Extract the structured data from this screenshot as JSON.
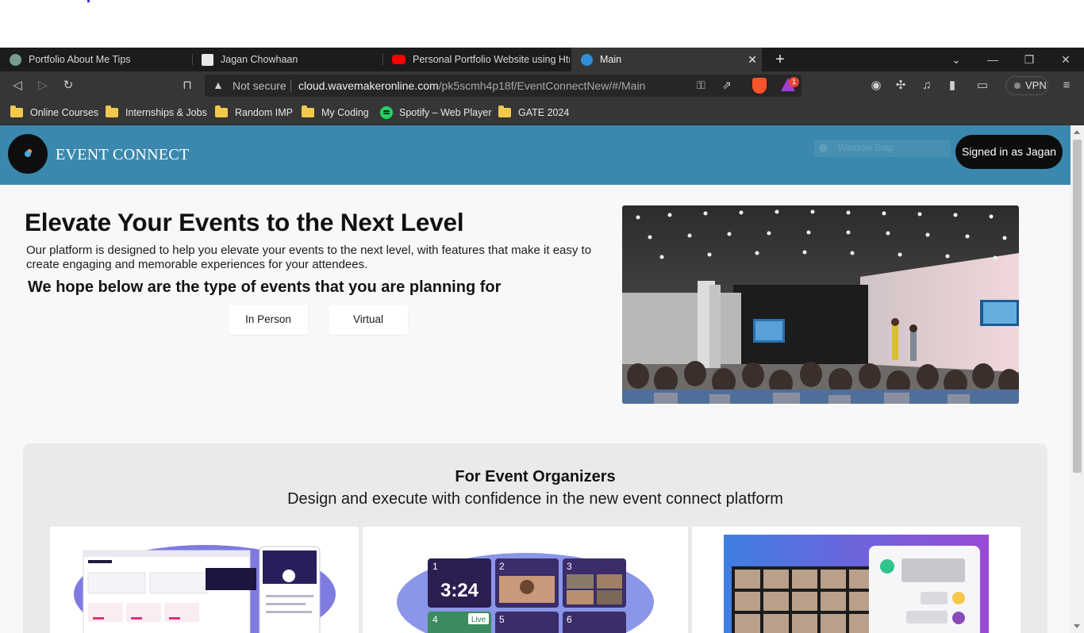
{
  "browser": {
    "tabs": [
      {
        "title": "Portfolio About Me Tips",
        "active": false
      },
      {
        "title": "Jagan Chowhaan",
        "active": false
      },
      {
        "title": "Personal Portfolio Website using Html",
        "active": false
      },
      {
        "title": "Main",
        "active": true
      }
    ],
    "address": {
      "security_label": "Not secure",
      "host": "cloud.wavemakeronline.com",
      "path": "/pk5scmh4p18f/EventConnectNew/#/Main"
    },
    "rewards_badge": "1",
    "vpn_label": "VPN",
    "bookmarks": [
      {
        "label": "Online Courses",
        "icon": "folder-icon"
      },
      {
        "label": "Internships & Jobs",
        "icon": "folder-icon"
      },
      {
        "label": "Random IMP",
        "icon": "folder-icon"
      },
      {
        "label": "My Coding",
        "icon": "folder-icon"
      },
      {
        "label": "Spotify – Web Player",
        "icon": "spotify-icon"
      },
      {
        "label": "GATE 2024",
        "icon": "folder-icon"
      }
    ]
  },
  "header": {
    "brand": "EVENT CONNECT",
    "snip_label": "Window Snip",
    "signin_label": "Signed in as Jagan",
    "bar_color": "#3a88ad"
  },
  "hero": {
    "title": "Elevate Your Events to the Next Level",
    "description": "Our platform is designed to help you elevate your events to the next level, with features that make it easy to create engaging and memorable experiences for your attendees.",
    "subtitle": "We hope below are the type of events that you are planning for",
    "buttons": [
      "In Person",
      "Virtual"
    ]
  },
  "organizers": {
    "title": "For Event Organizers",
    "subtitle": "Design and execute with confidence in the new event connect platform",
    "timer_text": "3:24",
    "tile_numbers": [
      "1",
      "2",
      "3",
      "4",
      "5",
      "6"
    ],
    "live_label": "Live"
  }
}
